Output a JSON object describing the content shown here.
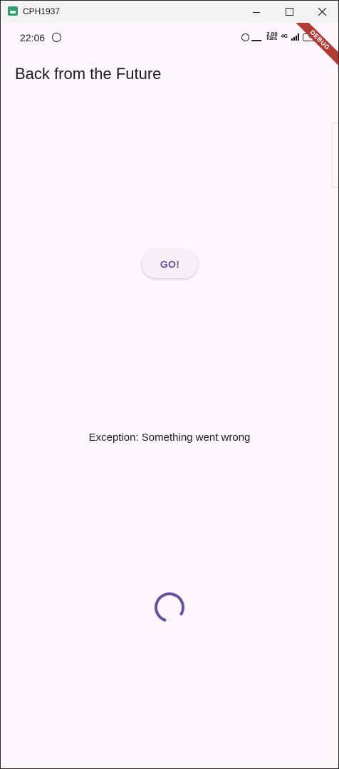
{
  "window": {
    "title": "CPH1937"
  },
  "statusbar": {
    "time": "22:06",
    "speed_value": "2.00",
    "speed_unit": "KB/S",
    "network": "4G",
    "battery": "6"
  },
  "debug_banner": "DEBUG",
  "app": {
    "title": "Back from the Future",
    "go_button_label": "GO!",
    "result_text": "Exception: Something went wrong"
  },
  "colors": {
    "accent": "#6750a4",
    "background": "#fdf7fd",
    "debug_banner": "#b13c34"
  },
  "icons": {
    "window_min": "minimize-icon",
    "window_max": "maximize-icon",
    "window_close": "close-icon",
    "spinner": "loading-spinner-icon"
  }
}
